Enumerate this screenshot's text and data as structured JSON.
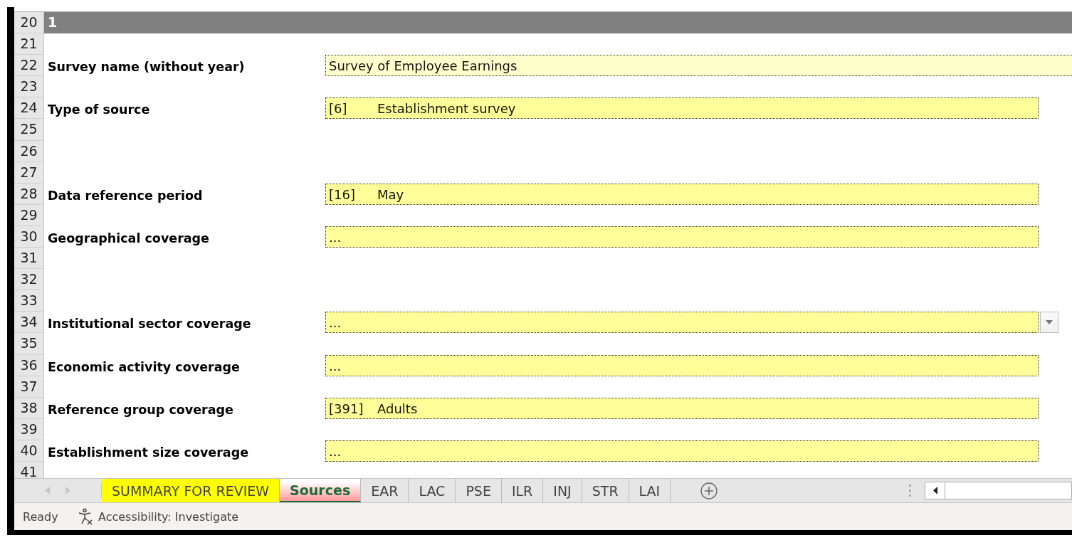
{
  "section": {
    "row": "20",
    "title": "1"
  },
  "rows": [
    {
      "row": "21"
    },
    {
      "row": "22",
      "label": "Survey name (without year)",
      "field": {
        "kind": "text",
        "value": "Survey of Employee Earnings"
      }
    },
    {
      "row": "23"
    },
    {
      "row": "24",
      "label": "Type of source",
      "field": {
        "kind": "coded",
        "code": "[6]",
        "value": "Establishment survey"
      }
    },
    {
      "row": "25"
    },
    {
      "row": "26"
    },
    {
      "row": "27"
    },
    {
      "row": "28",
      "label": "Data reference period",
      "field": {
        "kind": "coded",
        "code": "[16]",
        "value": "May"
      }
    },
    {
      "row": "29"
    },
    {
      "row": "30",
      "label": "Geographical coverage",
      "field": {
        "kind": "coded",
        "value": "..."
      }
    },
    {
      "row": "31"
    },
    {
      "row": "32"
    },
    {
      "row": "33"
    },
    {
      "row": "34",
      "label": "Institutional sector coverage",
      "field": {
        "kind": "coded",
        "value": "...",
        "dropdown": true
      }
    },
    {
      "row": "35"
    },
    {
      "row": "36",
      "label": "Economic activity coverage",
      "field": {
        "kind": "coded",
        "value": "..."
      }
    },
    {
      "row": "37"
    },
    {
      "row": "38",
      "label": "Reference group coverage",
      "field": {
        "kind": "coded",
        "code": "[391]",
        "value": "Adults"
      }
    },
    {
      "row": "39"
    },
    {
      "row": "40",
      "label": "Establishment size coverage",
      "field": {
        "kind": "coded",
        "value": "..."
      }
    },
    {
      "row": "41"
    }
  ],
  "sheet_tabs": [
    {
      "label": "SUMMARY FOR REVIEW",
      "selected": false,
      "color": "#ffff00"
    },
    {
      "label": "Sources",
      "selected": true,
      "color": "#ff9999"
    },
    {
      "label": "EAR",
      "selected": false
    },
    {
      "label": "LAC",
      "selected": false
    },
    {
      "label": "PSE",
      "selected": false
    },
    {
      "label": "ILR",
      "selected": false
    },
    {
      "label": "INJ",
      "selected": false
    },
    {
      "label": "STR",
      "selected": false
    },
    {
      "label": "LAI",
      "selected": false
    }
  ],
  "status_bar": {
    "mode": "Ready",
    "accessibility": "Accessibility: Investigate"
  }
}
